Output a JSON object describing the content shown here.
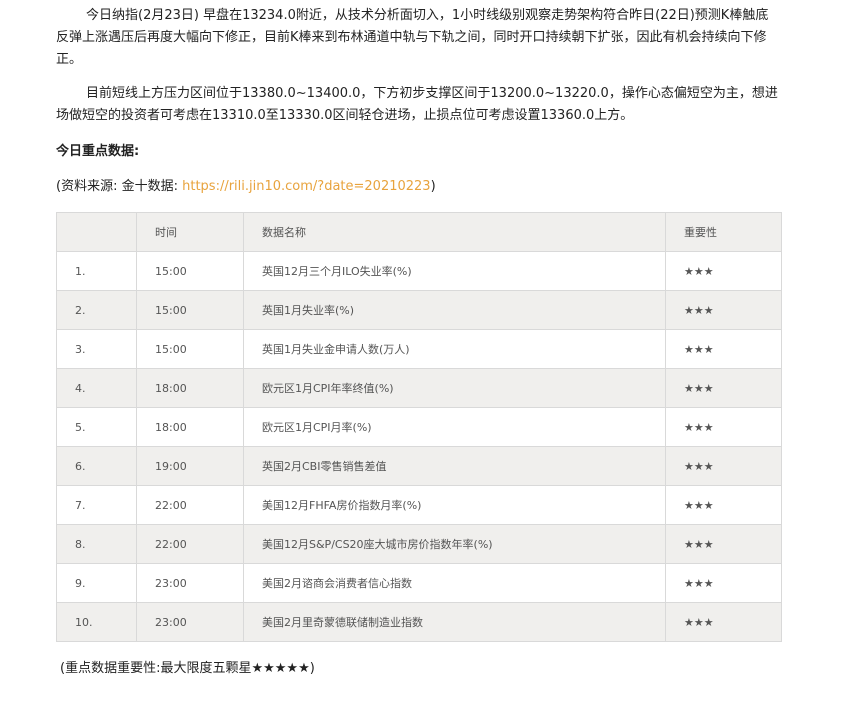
{
  "article": {
    "p1": "今日纳指(2月23日) 早盘在13234.0附近，从技术分析面切入，1小时线级别观察走势架构符合昨日(22日)预测K棒触底反弹上涨遇压后再度大幅向下修正，目前K棒来到布林通道中轨与下轨之间，同时开口持续朝下扩张，因此有机会持续向下修正。",
    "p2": "目前短线上方压力区间位于13380.0~13400.0，下方初步支撑区间于13200.0~13220.0，操作心态偏短空为主，想进场做短空的投资者可考虑在13310.0至13330.0区间轻仓进场，止损点位可考虑设置13360.0上方。",
    "section_title": "今日重点数据:",
    "source_prefix": "(资料来源: 金十数据: ",
    "source_link": "https://rili.jin10.com/?date=20210223",
    "source_suffix": ")",
    "footnote": "(重点数据重要性:最大限度五颗星★★★★★)"
  },
  "table": {
    "headers": [
      "",
      "时间",
      "数据名称",
      "重要性"
    ],
    "rows": [
      {
        "no": "1.",
        "time": "15:00",
        "name": "英国12月三个月ILO失业率(%)",
        "importance": "★★★"
      },
      {
        "no": "2.",
        "time": "15:00",
        "name": "英国1月失业率(%)",
        "importance": "★★★"
      },
      {
        "no": "3.",
        "time": "15:00",
        "name": "英国1月失业金申请人数(万人)",
        "importance": "★★★"
      },
      {
        "no": "4.",
        "time": "18:00",
        "name": "欧元区1月CPI年率终值(%)",
        "importance": "★★★"
      },
      {
        "no": "5.",
        "time": "18:00",
        "name": "欧元区1月CPI月率(%)",
        "importance": "★★★"
      },
      {
        "no": "6.",
        "time": "19:00",
        "name": "英国2月CBI零售销售差值",
        "importance": "★★★"
      },
      {
        "no": "7.",
        "time": "22:00",
        "name": "美国12月FHFA房价指数月率(%)",
        "importance": "★★★"
      },
      {
        "no": "8.",
        "time": "22:00",
        "name": "美国12月S&P/CS20座大城市房价指数年率(%)",
        "importance": "★★★"
      },
      {
        "no": "9.",
        "time": "23:00",
        "name": "美国2月谘商会消费者信心指数",
        "importance": "★★★"
      },
      {
        "no": "10.",
        "time": "23:00",
        "name": "美国2月里奇蒙德联储制造业指数",
        "importance": "★★★"
      }
    ]
  },
  "colors": {
    "link": "#e8a33d",
    "table_stripe": "#f0efed",
    "table_border": "#d9d9d9"
  }
}
